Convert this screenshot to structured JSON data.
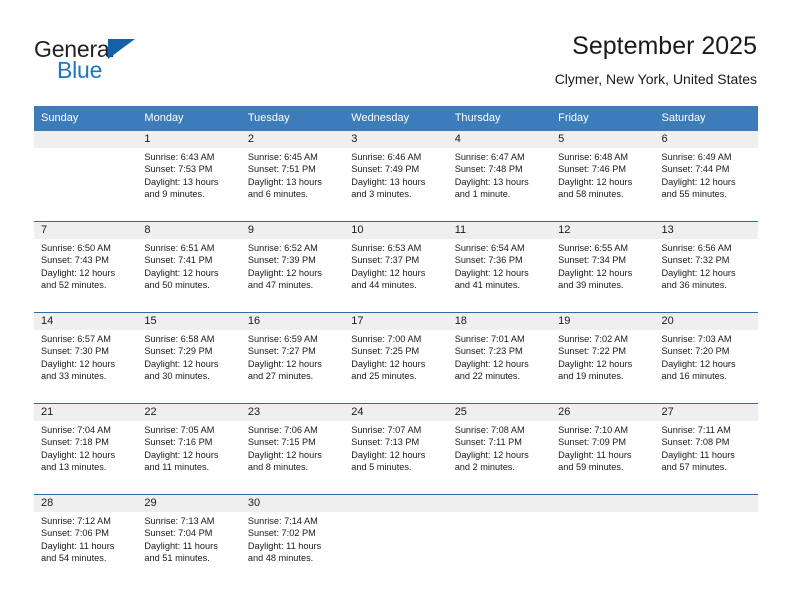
{
  "brand": {
    "name_top": "General",
    "name_bottom": "Blue",
    "triangle_color": "#1461a8",
    "blue_color": "#1c77c3",
    "dark_color": "#231f20"
  },
  "header": {
    "title": "September 2025",
    "subtitle": "Clymer, New York, United States"
  },
  "theme": {
    "header_row_bg": "#3c7cba",
    "header_row_text": "#ffffff",
    "daynum_bg": "#efefef",
    "row_divider": "#2e6ca4",
    "text": "#1a1a1a"
  },
  "weekdays": [
    "Sunday",
    "Monday",
    "Tuesday",
    "Wednesday",
    "Thursday",
    "Friday",
    "Saturday"
  ],
  "labels": {
    "sunrise_prefix": "Sunrise: ",
    "sunset_prefix": "Sunset: ",
    "daylight_prefix": "Daylight: "
  },
  "weeks": [
    [
      {
        "day": "",
        "sunrise": "",
        "sunset": "",
        "daylight_line1": "",
        "daylight_line2": ""
      },
      {
        "day": "1",
        "sunrise": "Sunrise: 6:43 AM",
        "sunset": "Sunset: 7:53 PM",
        "daylight_line1": "Daylight: 13 hours",
        "daylight_line2": "and 9 minutes."
      },
      {
        "day": "2",
        "sunrise": "Sunrise: 6:45 AM",
        "sunset": "Sunset: 7:51 PM",
        "daylight_line1": "Daylight: 13 hours",
        "daylight_line2": "and 6 minutes."
      },
      {
        "day": "3",
        "sunrise": "Sunrise: 6:46 AM",
        "sunset": "Sunset: 7:49 PM",
        "daylight_line1": "Daylight: 13 hours",
        "daylight_line2": "and 3 minutes."
      },
      {
        "day": "4",
        "sunrise": "Sunrise: 6:47 AM",
        "sunset": "Sunset: 7:48 PM",
        "daylight_line1": "Daylight: 13 hours",
        "daylight_line2": "and 1 minute."
      },
      {
        "day": "5",
        "sunrise": "Sunrise: 6:48 AM",
        "sunset": "Sunset: 7:46 PM",
        "daylight_line1": "Daylight: 12 hours",
        "daylight_line2": "and 58 minutes."
      },
      {
        "day": "6",
        "sunrise": "Sunrise: 6:49 AM",
        "sunset": "Sunset: 7:44 PM",
        "daylight_line1": "Daylight: 12 hours",
        "daylight_line2": "and 55 minutes."
      }
    ],
    [
      {
        "day": "7",
        "sunrise": "Sunrise: 6:50 AM",
        "sunset": "Sunset: 7:43 PM",
        "daylight_line1": "Daylight: 12 hours",
        "daylight_line2": "and 52 minutes."
      },
      {
        "day": "8",
        "sunrise": "Sunrise: 6:51 AM",
        "sunset": "Sunset: 7:41 PM",
        "daylight_line1": "Daylight: 12 hours",
        "daylight_line2": "and 50 minutes."
      },
      {
        "day": "9",
        "sunrise": "Sunrise: 6:52 AM",
        "sunset": "Sunset: 7:39 PM",
        "daylight_line1": "Daylight: 12 hours",
        "daylight_line2": "and 47 minutes."
      },
      {
        "day": "10",
        "sunrise": "Sunrise: 6:53 AM",
        "sunset": "Sunset: 7:37 PM",
        "daylight_line1": "Daylight: 12 hours",
        "daylight_line2": "and 44 minutes."
      },
      {
        "day": "11",
        "sunrise": "Sunrise: 6:54 AM",
        "sunset": "Sunset: 7:36 PM",
        "daylight_line1": "Daylight: 12 hours",
        "daylight_line2": "and 41 minutes."
      },
      {
        "day": "12",
        "sunrise": "Sunrise: 6:55 AM",
        "sunset": "Sunset: 7:34 PM",
        "daylight_line1": "Daylight: 12 hours",
        "daylight_line2": "and 39 minutes."
      },
      {
        "day": "13",
        "sunrise": "Sunrise: 6:56 AM",
        "sunset": "Sunset: 7:32 PM",
        "daylight_line1": "Daylight: 12 hours",
        "daylight_line2": "and 36 minutes."
      }
    ],
    [
      {
        "day": "14",
        "sunrise": "Sunrise: 6:57 AM",
        "sunset": "Sunset: 7:30 PM",
        "daylight_line1": "Daylight: 12 hours",
        "daylight_line2": "and 33 minutes."
      },
      {
        "day": "15",
        "sunrise": "Sunrise: 6:58 AM",
        "sunset": "Sunset: 7:29 PM",
        "daylight_line1": "Daylight: 12 hours",
        "daylight_line2": "and 30 minutes."
      },
      {
        "day": "16",
        "sunrise": "Sunrise: 6:59 AM",
        "sunset": "Sunset: 7:27 PM",
        "daylight_line1": "Daylight: 12 hours",
        "daylight_line2": "and 27 minutes."
      },
      {
        "day": "17",
        "sunrise": "Sunrise: 7:00 AM",
        "sunset": "Sunset: 7:25 PM",
        "daylight_line1": "Daylight: 12 hours",
        "daylight_line2": "and 25 minutes."
      },
      {
        "day": "18",
        "sunrise": "Sunrise: 7:01 AM",
        "sunset": "Sunset: 7:23 PM",
        "daylight_line1": "Daylight: 12 hours",
        "daylight_line2": "and 22 minutes."
      },
      {
        "day": "19",
        "sunrise": "Sunrise: 7:02 AM",
        "sunset": "Sunset: 7:22 PM",
        "daylight_line1": "Daylight: 12 hours",
        "daylight_line2": "and 19 minutes."
      },
      {
        "day": "20",
        "sunrise": "Sunrise: 7:03 AM",
        "sunset": "Sunset: 7:20 PM",
        "daylight_line1": "Daylight: 12 hours",
        "daylight_line2": "and 16 minutes."
      }
    ],
    [
      {
        "day": "21",
        "sunrise": "Sunrise: 7:04 AM",
        "sunset": "Sunset: 7:18 PM",
        "daylight_line1": "Daylight: 12 hours",
        "daylight_line2": "and 13 minutes."
      },
      {
        "day": "22",
        "sunrise": "Sunrise: 7:05 AM",
        "sunset": "Sunset: 7:16 PM",
        "daylight_line1": "Daylight: 12 hours",
        "daylight_line2": "and 11 minutes."
      },
      {
        "day": "23",
        "sunrise": "Sunrise: 7:06 AM",
        "sunset": "Sunset: 7:15 PM",
        "daylight_line1": "Daylight: 12 hours",
        "daylight_line2": "and 8 minutes."
      },
      {
        "day": "24",
        "sunrise": "Sunrise: 7:07 AM",
        "sunset": "Sunset: 7:13 PM",
        "daylight_line1": "Daylight: 12 hours",
        "daylight_line2": "and 5 minutes."
      },
      {
        "day": "25",
        "sunrise": "Sunrise: 7:08 AM",
        "sunset": "Sunset: 7:11 PM",
        "daylight_line1": "Daylight: 12 hours",
        "daylight_line2": "and 2 minutes."
      },
      {
        "day": "26",
        "sunrise": "Sunrise: 7:10 AM",
        "sunset": "Sunset: 7:09 PM",
        "daylight_line1": "Daylight: 11 hours",
        "daylight_line2": "and 59 minutes."
      },
      {
        "day": "27",
        "sunrise": "Sunrise: 7:11 AM",
        "sunset": "Sunset: 7:08 PM",
        "daylight_line1": "Daylight: 11 hours",
        "daylight_line2": "and 57 minutes."
      }
    ],
    [
      {
        "day": "28",
        "sunrise": "Sunrise: 7:12 AM",
        "sunset": "Sunset: 7:06 PM",
        "daylight_line1": "Daylight: 11 hours",
        "daylight_line2": "and 54 minutes."
      },
      {
        "day": "29",
        "sunrise": "Sunrise: 7:13 AM",
        "sunset": "Sunset: 7:04 PM",
        "daylight_line1": "Daylight: 11 hours",
        "daylight_line2": "and 51 minutes."
      },
      {
        "day": "30",
        "sunrise": "Sunrise: 7:14 AM",
        "sunset": "Sunset: 7:02 PM",
        "daylight_line1": "Daylight: 11 hours",
        "daylight_line2": "and 48 minutes."
      },
      {
        "day": "",
        "sunrise": "",
        "sunset": "",
        "daylight_line1": "",
        "daylight_line2": ""
      },
      {
        "day": "",
        "sunrise": "",
        "sunset": "",
        "daylight_line1": "",
        "daylight_line2": ""
      },
      {
        "day": "",
        "sunrise": "",
        "sunset": "",
        "daylight_line1": "",
        "daylight_line2": ""
      },
      {
        "day": "",
        "sunrise": "",
        "sunset": "",
        "daylight_line1": "",
        "daylight_line2": ""
      }
    ]
  ]
}
